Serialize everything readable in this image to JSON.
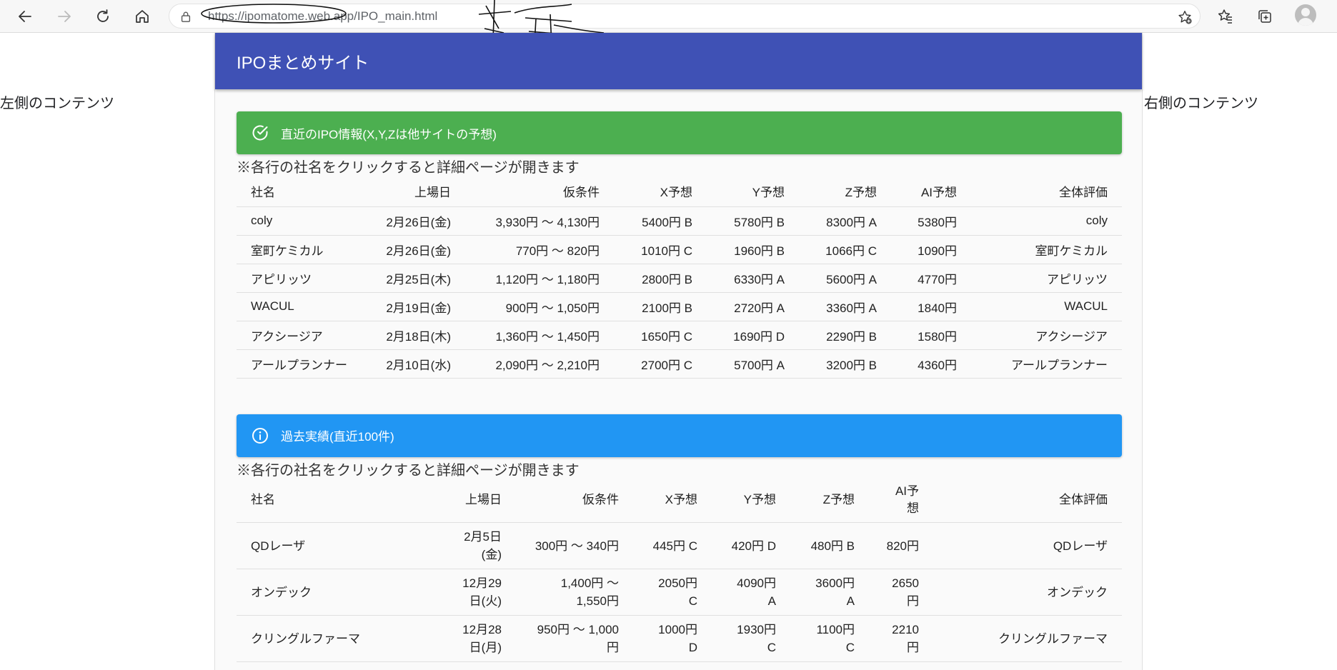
{
  "browser": {
    "url": "https://ipomatome.web.app/IPO_main.html",
    "icons": [
      "back-arrow-icon",
      "forward-arrow-icon",
      "reload-icon",
      "home-icon",
      "lock-icon",
      "add-favorite-icon",
      "favorites-icon",
      "collections-icon",
      "profile-icon"
    ]
  },
  "side": {
    "left": "左側のコンテンツ",
    "right": "右側のコンテンツ"
  },
  "header": {
    "title": "IPOまとめサイト",
    "color": "#3f51b5"
  },
  "recent": {
    "alert": "直近のIPO情報(X,Y,Zは他サイトの予想)",
    "alert_color": "#4caf50",
    "note": "※各行の社名をクリックすると詳細ページが開きます",
    "columns": [
      "社名",
      "上場日",
      "仮条件",
      "X予想",
      "Y予想",
      "Z予想",
      "AI予想",
      "全体評価"
    ],
    "rows": [
      [
        "coly",
        "2月26日(金)",
        "3,930円 ～ 4,130円",
        "5400円 B",
        "5780円 B",
        "8300円 A",
        "5380円",
        "coly"
      ],
      [
        "室町ケミカル",
        "2月26日(金)",
        "770円 ～ 820円",
        "1010円 C",
        "1960円 B",
        "1066円 C",
        "1090円",
        "室町ケミカル"
      ],
      [
        "アピリッツ",
        "2月25日(木)",
        "1,120円 ～ 1,180円",
        "2800円 B",
        "6330円 A",
        "5600円 A",
        "4770円",
        "アピリッツ"
      ],
      [
        "WACUL",
        "2月19日(金)",
        "900円 ～ 1,050円",
        "2100円 B",
        "2720円 A",
        "3360円 A",
        "1840円",
        "WACUL"
      ],
      [
        "アクシージア",
        "2月18日(木)",
        "1,360円 ～ 1,450円",
        "1650円 C",
        "1690円 D",
        "2290円 B",
        "1580円",
        "アクシージア"
      ],
      [
        "アールプランナー",
        "2月10日(水)",
        "2,090円 ～ 2,210円",
        "2700円 C",
        "5700円 A",
        "3200円 B",
        "4360円",
        "アールプランナー"
      ]
    ]
  },
  "past": {
    "alert": "過去実績(直近100件)",
    "alert_color": "#2196f3",
    "note": "※各行の社名をクリックすると詳細ページが開きます",
    "columns": [
      "社名",
      "上場日",
      "仮条件",
      "X予想",
      "Y予想",
      "Z予想",
      "AI予想",
      "全体評価"
    ],
    "rows": [
      [
        "QDレーザ",
        "2月5日(金)",
        "300円 ～ 340円",
        "445円 C",
        "420円 D",
        "480円 B",
        "820円",
        "QDレーザ"
      ],
      [
        "オンデック",
        "12月29日(火)",
        "1,400円 ～ 1,550円",
        "2050円 C",
        "4090円 A",
        "3600円 A",
        "2650円",
        "オンデック"
      ],
      [
        "クリングルファーマ",
        "12月28日(月)",
        "950円 ～ 1,000円",
        "1000円 D",
        "1930円 C",
        "1100円 C",
        "2210円",
        "クリングルファーマ"
      ]
    ]
  }
}
